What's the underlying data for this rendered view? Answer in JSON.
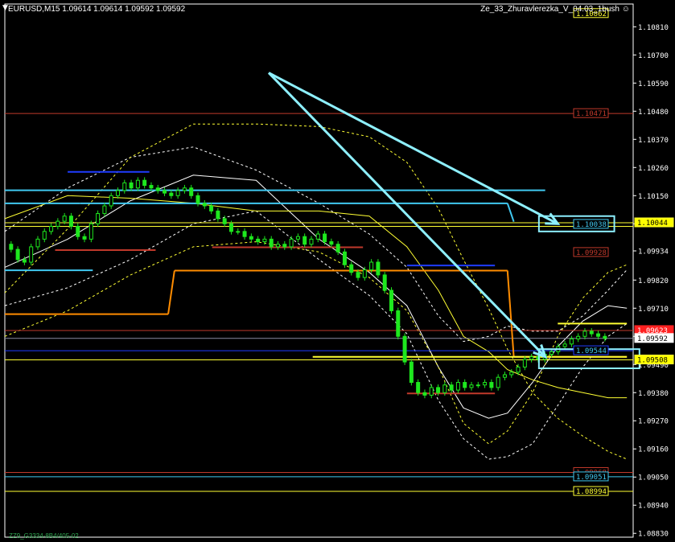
{
  "header": {
    "symbol_info": "EURUSD,M15  1.09614 1.09614 1.09592 1.09592",
    "indicator": "Ze_33_Zhuravlerezka_V_04.03_1bush",
    "smiley": "☺",
    "arrow": "▼"
  },
  "footer": {
    "label": "ZZ9_G3334-8B4/405-02"
  },
  "colors": {
    "background": "#000000",
    "axis": "#ffffff",
    "grid_text": "#ffffff",
    "red_line": "#c0392b",
    "yellow_line": "#ffff33",
    "cyan_line": "#40c8f0",
    "blue_line": "#1f3cff",
    "orange_line": "#ff8c00",
    "arrow": "#8ef0ff",
    "candle": "#1ee81e",
    "bid_line": "#8a8aa0"
  },
  "chart_data": {
    "type": "candlestick",
    "title": "EURUSD,M15",
    "ylim": [
      1.08815,
      1.10899
    ],
    "y_ticks": [
      "1.10810",
      "1.10700",
      "1.10590",
      "1.10480",
      "1.10370",
      "1.10260",
      "1.10150",
      "1.10040",
      "1.09934",
      "1.09820",
      "1.09710",
      "1.09600",
      "1.09490",
      "1.09380",
      "1.09270",
      "1.09160",
      "1.09050",
      "1.08940",
      "1.08830"
    ],
    "price_labels": [
      {
        "text": "1.10862",
        "value": 1.10862,
        "color": "#ffff33",
        "fill": "#000000",
        "text_color": "#ffff33"
      },
      {
        "text": "1.10471",
        "value": 1.10471,
        "color": "#c0392b",
        "fill": "#000000",
        "text_color": "#c0392b"
      },
      {
        "text": "1.10038",
        "value": 1.10038,
        "color": "#40c8f0",
        "fill": "#000000",
        "text_color": "#40c8f0"
      },
      {
        "text": "1.10044",
        "value": 1.10044,
        "color": "#ffff33",
        "fill": "#ffff00",
        "text_color": "#000000",
        "axis": true
      },
      {
        "text": "1.09928",
        "value": 1.09928,
        "color": "#c0392b",
        "fill": "#000000",
        "text_color": "#c0392b"
      },
      {
        "text": "1.09623",
        "value": 1.09623,
        "color": "#ff2020",
        "fill": "#ff2020",
        "text_color": "#ffffff",
        "axis": true
      },
      {
        "text": "1.09592",
        "value": 1.09592,
        "color": "#ffffff",
        "fill": "#ffffff",
        "text_color": "#000000",
        "axis": true
      },
      {
        "text": "1.09544",
        "value": 1.09544,
        "color": "#1f3cff",
        "fill": "#000000",
        "text_color": "#40c8f0"
      },
      {
        "text": "1.09508",
        "value": 1.09508,
        "color": "#ffff33",
        "fill": "#ffff00",
        "text_color": "#000000",
        "axis": true
      },
      {
        "text": "1.09068",
        "value": 1.09068,
        "color": "#c0392b",
        "fill": "#000000",
        "text_color": "#c0392b"
      },
      {
        "text": "1.09051",
        "value": 1.09051,
        "color": "#40c8f0",
        "fill": "#000000",
        "text_color": "#40c8f0"
      },
      {
        "text": "1.08994",
        "value": 1.08994,
        "color": "#ffff33",
        "fill": "#000000",
        "text_color": "#ffff33"
      }
    ],
    "horizontal_lines": [
      {
        "value": 1.10471,
        "color": "#c0392b",
        "style": "solid"
      },
      {
        "value": 1.10044,
        "color": "#ffff33",
        "style": "solid"
      },
      {
        "value": 1.1003,
        "color": "#ffff33",
        "style": "solid"
      },
      {
        "value": 1.09623,
        "color": "#c0392b",
        "style": "solid"
      },
      {
        "value": 1.09592,
        "color": "#8a8aa0",
        "style": "solid"
      },
      {
        "value": 1.09544,
        "color": "#1f3cff",
        "style": "solid"
      },
      {
        "value": 1.09508,
        "color": "#ffff33",
        "style": "solid"
      },
      {
        "value": 1.09068,
        "color": "#c0392b",
        "style": "solid"
      },
      {
        "value": 1.09051,
        "color": "#40c8f0",
        "style": "solid"
      },
      {
        "value": 1.08994,
        "color": "#ffff33",
        "style": "solid"
      }
    ],
    "segments": [
      {
        "x": [
          0.0,
          0.86
        ],
        "y": [
          1.10171,
          1.10171
        ],
        "color": "#40c8f0"
      },
      {
        "x": [
          0.0,
          0.12
        ],
        "y": [
          1.1012,
          1.1012
        ],
        "color": "#40c8f0"
      },
      {
        "x": [
          0.12,
          0.8
        ],
        "y": [
          1.1012,
          1.1012
        ],
        "color": "#40c8f0"
      },
      {
        "x": [
          0.8,
          0.81
        ],
        "y": [
          1.1012,
          1.10048
        ],
        "color": "#40c8f0"
      },
      {
        "x": [
          0.0,
          0.14
        ],
        "y": [
          1.09858,
          1.09858
        ],
        "color": "#40c8f0"
      },
      {
        "x": [
          0.1,
          0.23
        ],
        "y": [
          1.10243,
          1.10243
        ],
        "color": "#1f3cff"
      },
      {
        "x": [
          0.64,
          0.78
        ],
        "y": [
          1.09877,
          1.09877
        ],
        "color": "#1f3cff"
      },
      {
        "x": [
          0.0,
          0.26
        ],
        "y": [
          1.09687,
          1.09687
        ],
        "color": "#ff8c00"
      },
      {
        "x": [
          0.26,
          0.27
        ],
        "y": [
          1.09687,
          1.09857
        ],
        "color": "#ff8c00"
      },
      {
        "x": [
          0.27,
          0.8
        ],
        "y": [
          1.09857,
          1.09857
        ],
        "color": "#ff8c00"
      },
      {
        "x": [
          0.8,
          0.81
        ],
        "y": [
          1.09857,
          1.0952
        ],
        "color": "#ff8c00"
      },
      {
        "x": [
          0.81,
          0.99
        ],
        "y": [
          1.0952,
          1.0952
        ],
        "color": "#ff8c00"
      },
      {
        "x": [
          0.08,
          0.24
        ],
        "y": [
          1.09937,
          1.09937
        ],
        "color": "#c0392b"
      },
      {
        "x": [
          0.33,
          0.57
        ],
        "y": [
          1.09948,
          1.09948
        ],
        "color": "#c0392b"
      },
      {
        "x": [
          0.64,
          0.78
        ],
        "y": [
          1.09377,
          1.09377
        ],
        "color": "#c0392b"
      },
      {
        "x": [
          0.88,
          0.99
        ],
        "y": [
          1.0965,
          1.0965
        ],
        "color": "#ffff33"
      },
      {
        "x": [
          0.49,
          0.99
        ],
        "y": [
          1.0952,
          1.0952
        ],
        "color": "#ffff33"
      }
    ],
    "arrows": [
      {
        "x": [
          0.42,
          0.88
        ],
        "y": [
          1.1063,
          1.1004
        ],
        "color": "#8ef0ff"
      },
      {
        "x": [
          0.42,
          0.86
        ],
        "y": [
          1.1063,
          1.0952
        ],
        "color": "#8ef0ff"
      }
    ],
    "boxes": [
      {
        "x": [
          0.85,
          0.97
        ],
        "y": [
          1.1007,
          1.1001
        ],
        "color": "#8ef0ff"
      },
      {
        "x": [
          0.85,
          1.01
        ],
        "y": [
          1.0955,
          1.09475
        ],
        "color": "#8ef0ff"
      }
    ],
    "curves": [
      {
        "name": "",
        "color": "#ffffff",
        "dash": "none",
        "x": [
          0.0,
          0.1,
          0.2,
          0.3,
          0.4,
          0.5,
          0.58,
          0.64,
          0.69,
          0.73,
          0.77,
          0.8,
          0.84,
          0.88,
          0.92,
          0.96,
          0.99
        ],
        "y": [
          1.0987,
          1.0998,
          1.1013,
          1.1023,
          1.1021,
          1.0998,
          1.0985,
          1.0972,
          1.0948,
          1.0932,
          1.0928,
          1.093,
          1.0942,
          1.0956,
          1.0966,
          1.0972,
          1.0971
        ]
      },
      {
        "name": "",
        "color": "#ffffff",
        "dash": "3,3",
        "x": [
          0.0,
          0.1,
          0.2,
          0.3,
          0.4,
          0.5,
          0.58,
          0.64,
          0.69,
          0.73,
          0.77,
          0.8,
          0.84,
          0.88,
          0.92,
          0.96,
          0.99
        ],
        "y": [
          1.1001,
          1.1018,
          1.103,
          1.1034,
          1.1025,
          1.1012,
          1.1,
          1.0987,
          1.0968,
          1.0958,
          1.096,
          1.0964,
          1.0962,
          1.0962,
          1.0968,
          1.0978,
          1.0986
        ]
      },
      {
        "name": "",
        "color": "#ffffff",
        "dash": "3,3",
        "x": [
          0.0,
          0.1,
          0.2,
          0.3,
          0.4,
          0.5,
          0.58,
          0.64,
          0.69,
          0.73,
          0.77,
          0.8,
          0.84,
          0.88,
          0.92,
          0.96,
          0.99
        ],
        "y": [
          1.0972,
          1.0979,
          1.099,
          1.1004,
          1.1009,
          1.099,
          1.0976,
          1.0961,
          1.0935,
          1.092,
          1.0912,
          1.0913,
          1.0918,
          1.0933,
          1.0948,
          1.096,
          1.0965
        ]
      },
      {
        "name": "",
        "color": "#ffff33",
        "dash": "3,3",
        "x": [
          0.0,
          0.1,
          0.2,
          0.3,
          0.4,
          0.5,
          0.58,
          0.64,
          0.69,
          0.73,
          0.77,
          0.8,
          0.84,
          0.88,
          0.92,
          0.96,
          0.99
        ],
        "y": [
          1.0977,
          1.1002,
          1.103,
          1.1043,
          1.1043,
          1.1042,
          1.1038,
          1.1028,
          1.101,
          1.099,
          1.0971,
          1.0955,
          1.0938,
          1.0928,
          1.0921,
          1.0915,
          1.0912
        ]
      },
      {
        "name": "",
        "color": "#ffff33",
        "dash": "3,3",
        "x": [
          0.0,
          0.1,
          0.2,
          0.3,
          0.4,
          0.5,
          0.58,
          0.64,
          0.69,
          0.73,
          0.77,
          0.8,
          0.84,
          0.88,
          0.92,
          0.96,
          0.99
        ],
        "y": [
          1.096,
          1.097,
          1.0984,
          1.0995,
          1.0997,
          1.0993,
          1.0983,
          1.097,
          1.0948,
          1.0926,
          1.0918,
          1.0923,
          1.0938,
          1.096,
          1.0975,
          1.0985,
          1.0988
        ]
      },
      {
        "name": "",
        "color": "#ffff33",
        "dash": "none",
        "x": [
          0.0,
          0.1,
          0.2,
          0.3,
          0.4,
          0.5,
          0.58,
          0.64,
          0.69,
          0.73,
          0.77,
          0.8,
          0.84,
          0.88,
          0.92,
          0.96,
          0.99
        ],
        "y": [
          1.1006,
          1.1015,
          1.1014,
          1.1012,
          1.1009,
          1.1009,
          1.1007,
          1.0995,
          1.0978,
          1.096,
          1.0954,
          1.0947,
          1.0943,
          1.094,
          1.0938,
          1.0936,
          1.0936
        ]
      }
    ],
    "candles": {
      "x_start": 0.01,
      "x_end": 0.955,
      "close": [
        1.0994,
        1.099,
        1.0989,
        1.0995,
        1.0998,
        1.1001,
        1.1003,
        1.1005,
        1.1007,
        1.1003,
        1.0999,
        1.0998,
        1.1004,
        1.1008,
        1.1011,
        1.1015,
        1.1017,
        1.102,
        1.1018,
        1.1021,
        1.1019,
        1.1018,
        1.1017,
        1.1016,
        1.1015,
        1.1017,
        1.1018,
        1.1015,
        1.1012,
        1.1011,
        1.1009,
        1.1006,
        1.1004,
        1.1001,
        1.1001,
        1.0999,
        1.0998,
        1.0997,
        1.0998,
        1.0995,
        1.0996,
        1.0995,
        1.0998,
        1.0999,
        1.0996,
        1.0998,
        1.1,
        1.0997,
        1.0996,
        1.0993,
        1.0988,
        1.0985,
        1.0983,
        1.0986,
        1.0989,
        1.0984,
        1.0978,
        1.097,
        1.096,
        1.095,
        1.0942,
        1.0938,
        1.0937,
        1.094,
        1.0938,
        1.0941,
        1.0939,
        1.0942,
        1.094,
        1.0941,
        1.0941,
        1.0942,
        1.094,
        1.0944,
        1.0945,
        1.0946,
        1.0948,
        1.0951,
        1.0952,
        1.0951,
        1.0953,
        1.0954,
        1.0956,
        1.0957,
        1.0959,
        1.096,
        1.0962,
        1.0961,
        1.096,
        1.09592
      ]
    }
  }
}
